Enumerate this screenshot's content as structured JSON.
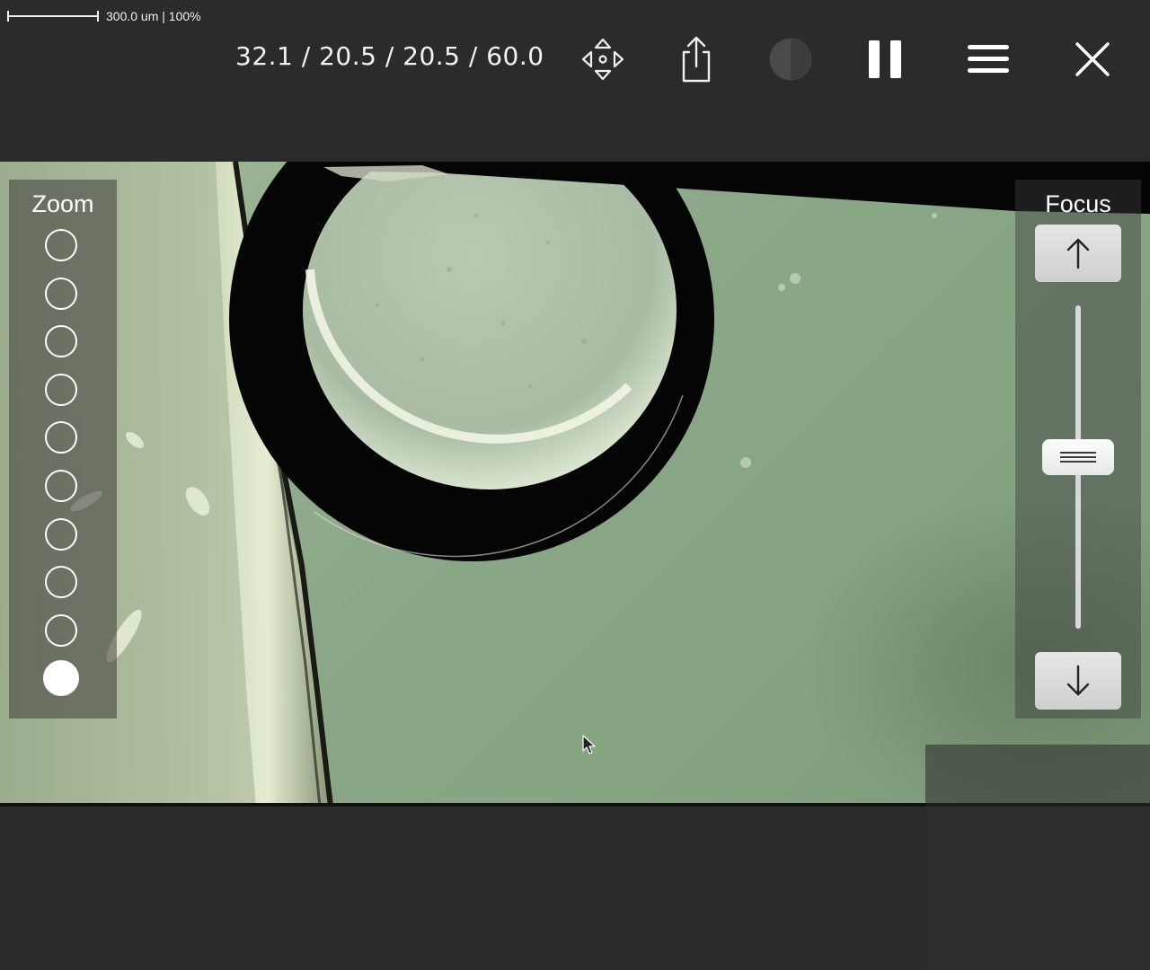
{
  "scale": {
    "text": "300.0 um | 100%"
  },
  "coordinates": {
    "text": "32.1 / 20.5 / 20.5 / 60.0"
  },
  "toolbar": {
    "buttons": [
      {
        "name": "move-arrows-icon"
      },
      {
        "name": "share-icon"
      },
      {
        "name": "contrast-icon"
      },
      {
        "name": "pause-icon"
      },
      {
        "name": "menu-icon"
      },
      {
        "name": "close-icon"
      }
    ]
  },
  "zoom": {
    "title": "Zoom",
    "levels": 10,
    "selected_index": 9
  },
  "focus": {
    "title": "Focus",
    "up_icon": "arrow-up-icon",
    "down_icon": "arrow-down-icon",
    "slider_level": 0.42
  },
  "colors": {
    "background": "#2b2b2b",
    "viewport_tint": "#8aa787",
    "accent": "#ffffff"
  }
}
